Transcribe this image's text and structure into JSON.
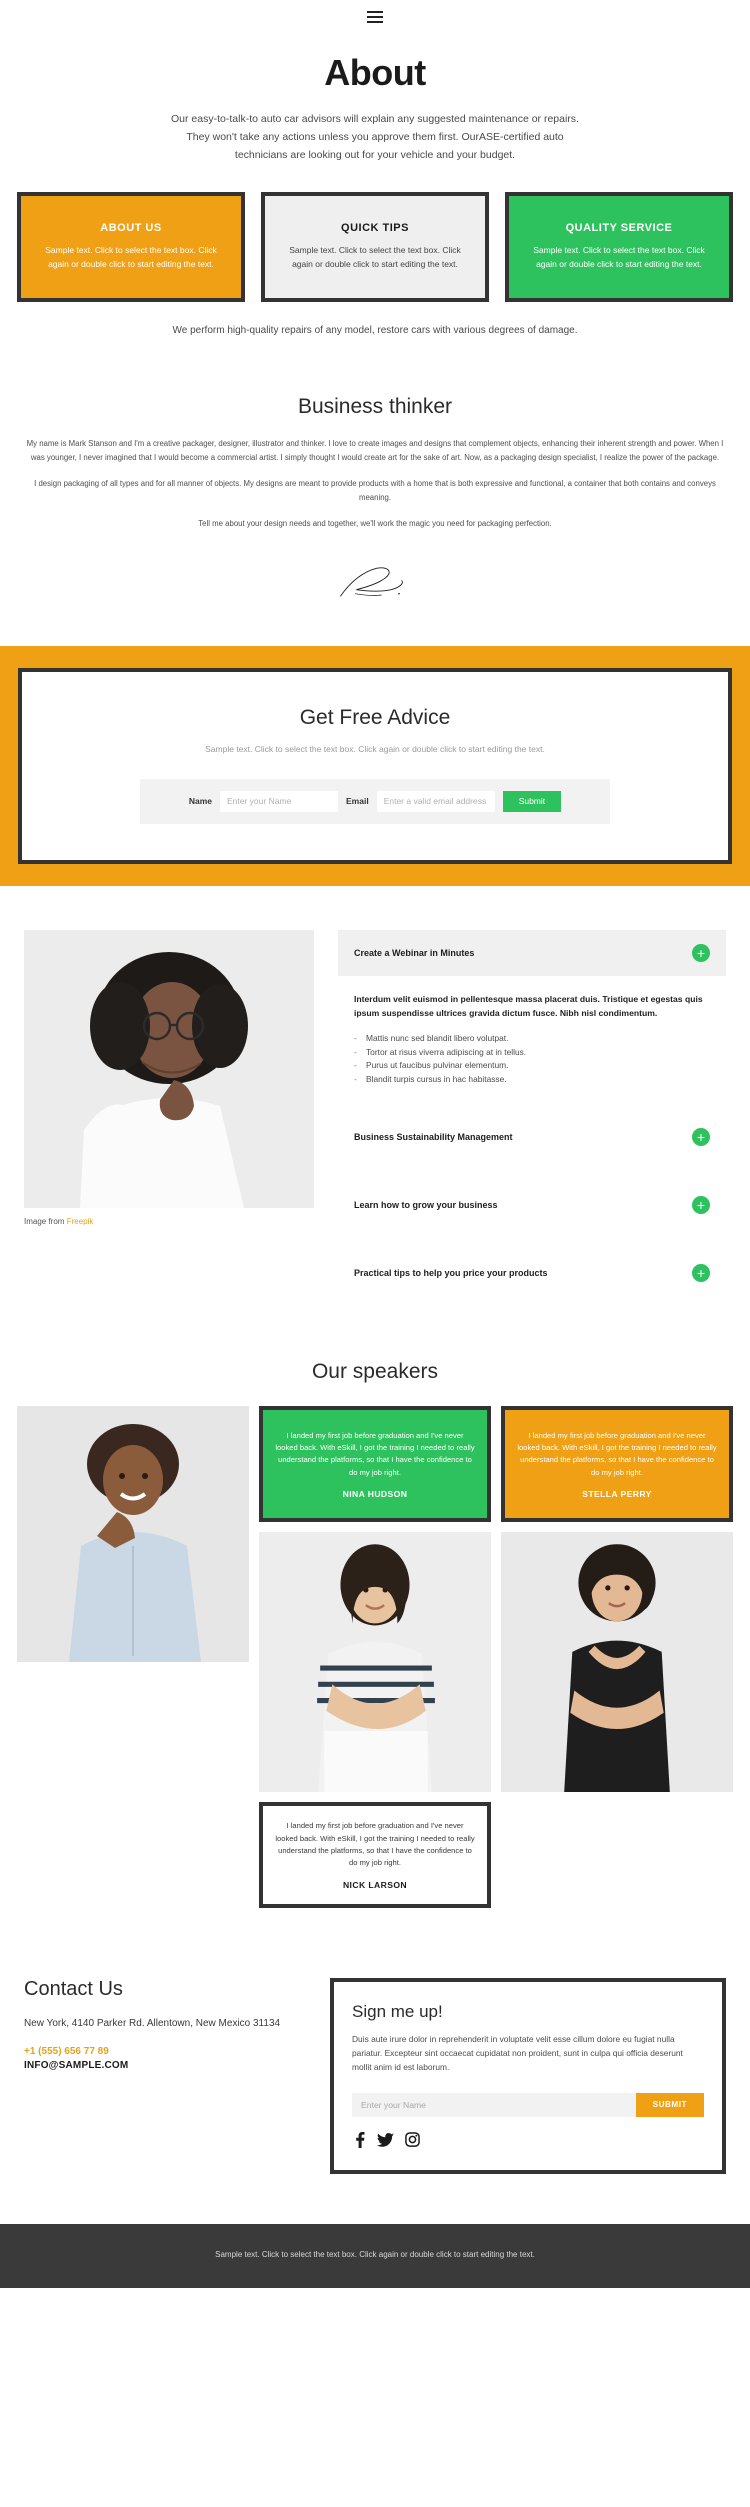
{
  "nav": {
    "menu_icon": "hamburger-menu-icon"
  },
  "hero": {
    "title": "About",
    "paragraph": "Our easy-to-talk-to auto car advisors will explain any suggested maintenance or repairs. They won't take any actions unless you approve them first. OurASE-certified auto technicians are looking out for your vehicle and your budget."
  },
  "feature_cards": [
    {
      "title": "ABOUT US",
      "body": "Sample text. Click to select the text box. Click again or double click to start editing the text.",
      "bg": "#efa014"
    },
    {
      "title": "QUICK TIPS",
      "body": "Sample text. Click to select the text box. Click again or double click to start editing the text.",
      "bg": "#efefef"
    },
    {
      "title": "QUALITY SERVICE",
      "body": "Sample text. Click to select the text box. Click again or double click to start editing the text.",
      "bg": "#2ec25e"
    }
  ],
  "cards_note": "We perform high-quality repairs of any model, restore cars with various degrees of damage.",
  "thinker": {
    "title": "Business thinker",
    "p1": "My name is Mark Stanson and I'm a creative packager, designer, illustrator and thinker. I love to create images and designs that complement objects, enhancing their inherent strength and power. When I was younger, I never imagined that I would become a commercial artist. I simply thought I would create art for the sake of art. Now, as a packaging design specialist, I realize the power of the package.",
    "p2": "I design packaging of all types and for all manner of objects. My designs are meant to provide products with a home that is both expressive and functional, a container that both contains and conveys meaning.",
    "p3": "Tell me about your design needs and together, we'll work the magic you need for packaging perfection."
  },
  "advice": {
    "title": "Get Free Advice",
    "subtitle": "Sample text. Click to select the text box. Click again or double click to start editing the text.",
    "name_label": "Name",
    "name_placeholder": "Enter your Name",
    "email_label": "Email",
    "email_placeholder": "Enter a valid email address",
    "submit_label": "Submit",
    "band_color": "#efa014",
    "submit_color": "#2ec25e"
  },
  "webinar": {
    "photo_credit_prefix": "Image from ",
    "photo_credit_link": "Freepik",
    "accordion_open_title": "Create a Webinar in Minutes",
    "lead": "Interdum velit euismod in pellentesque massa placerat duis. Tristique et egestas quis ipsum suspendisse ultrices gravida dictum fusce. Nibh nisl condimentum.",
    "bullets": [
      "Mattis nunc sed blandit libero volutpat.",
      "Tortor at risus viverra adipiscing at in tellus.",
      "Purus ut faucibus pulvinar elementum.",
      "Blandit turpis cursus in hac habitasse."
    ],
    "rows": [
      {
        "title": "Business Sustainability Management",
        "icon": "plus-icon"
      },
      {
        "title": "Learn how to grow your business",
        "icon": "plus-icon"
      },
      {
        "title": "Practical tips to help you price your products",
        "icon": "plus-icon"
      }
    ]
  },
  "speakers": {
    "title": "Our speakers",
    "quote_text": "I landed my first job before graduation and I've never looked back. With eSkill, I got the training I needed to really understand the platforms, so that I have the confidence to do my job right.",
    "items": [
      {
        "name": "NINA HUDSON",
        "style": "green"
      },
      {
        "name": "STELLA PERRY",
        "style": "orange"
      },
      {
        "name": "NICK LARSON",
        "style": "white"
      }
    ]
  },
  "contact": {
    "title": "Contact Us",
    "address": "New York, 4140 Parker Rd. Allentown, New Mexico 31134",
    "phone": "+1 (555) 656 77 89",
    "email": "INFO@SAMPLE.COM",
    "phone_color": "#e0a422"
  },
  "signup": {
    "title": "Sign me up!",
    "body": "Duis aute irure dolor in reprehenderit in voluptate velit esse cillum dolore eu fugiat nulla pariatur. Excepteur sint occaecat cupidatat non proident, sunt in culpa qui officia deserunt mollit anim id est laborum.",
    "name_placeholder": "Enter your Name",
    "submit_label": "SUBMIT",
    "submit_color": "#efa014",
    "socials": [
      "facebook-icon",
      "twitter-icon",
      "instagram-icon"
    ]
  },
  "footer": {
    "text": "Sample text. Click to select the text box. Click again or double click to start editing the text."
  }
}
